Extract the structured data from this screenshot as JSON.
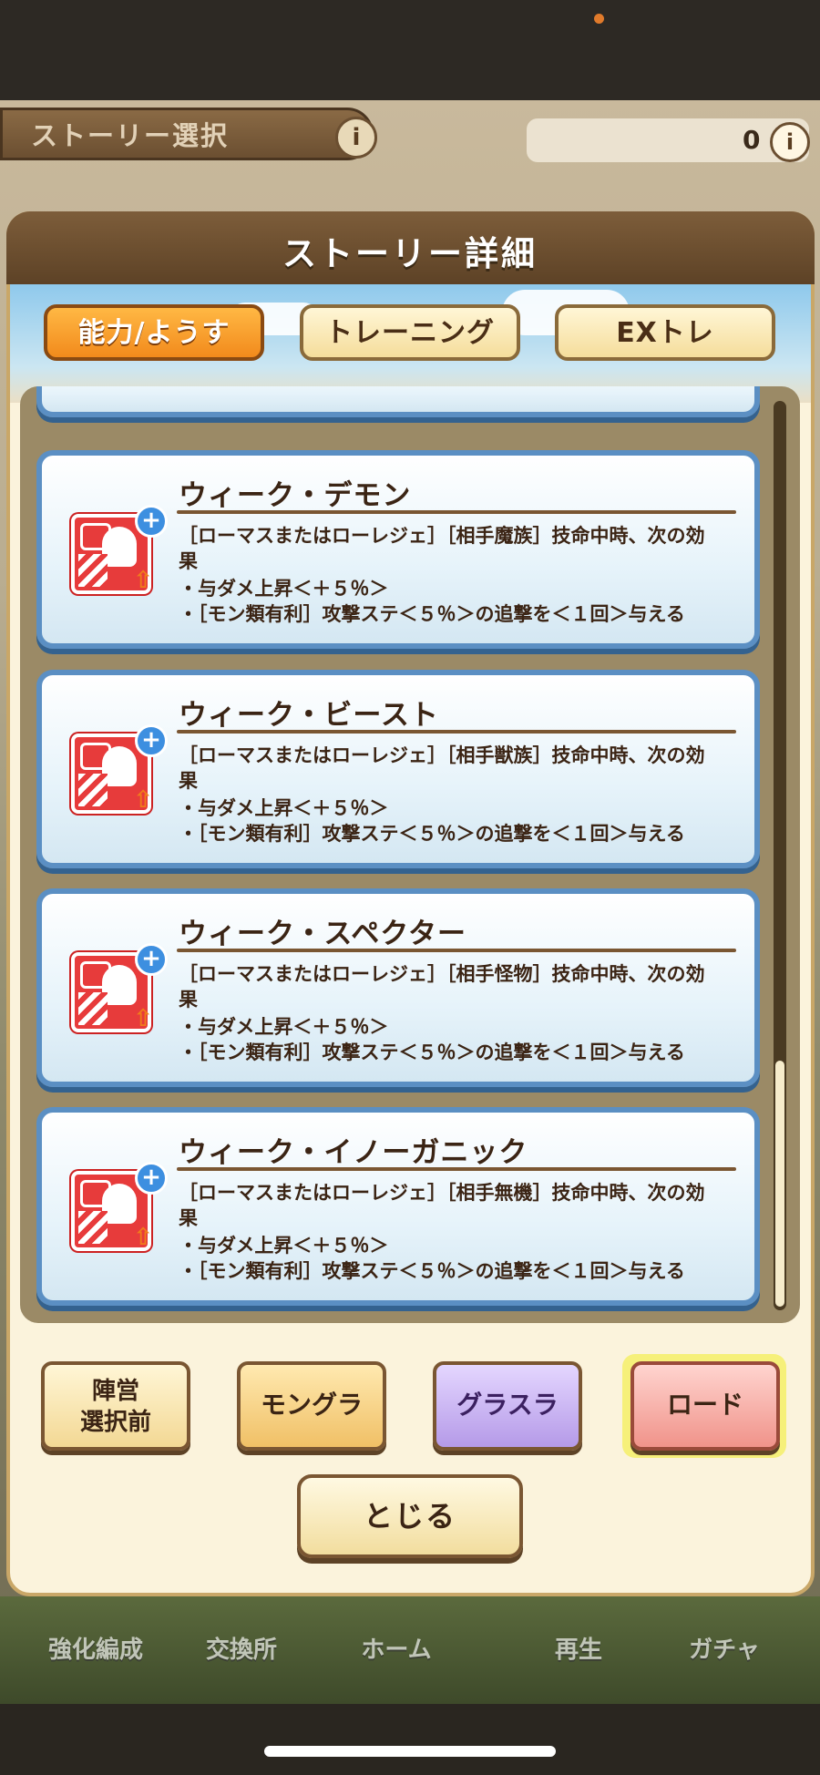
{
  "background": {
    "header_title": "ストーリー選択",
    "currency_value": "0",
    "info_glyph": "i",
    "nav_items": [
      "強化編成",
      "交換所",
      "ホーム",
      "再生",
      "ガチャ"
    ]
  },
  "modal": {
    "title": "ストーリー詳細",
    "tabs": [
      {
        "label": "能力/ようす",
        "active": true
      },
      {
        "label": "トレーニング",
        "active": false
      },
      {
        "label": "EXトレ",
        "active": false
      }
    ],
    "cards": [
      {
        "title": "ウィーク・デモン",
        "icon": "attack-up-icon",
        "lines": [
          "［ローマスまたはローレジェ］［相手魔族］技命中時、次の効",
          "果",
          "・与ダメ上昇＜＋５％＞",
          "・［モン類有利］攻撃ステ＜５％＞の追撃を＜１回＞与える"
        ]
      },
      {
        "title": "ウィーク・ビースト",
        "icon": "attack-up-icon",
        "lines": [
          "［ローマスまたはローレジェ］［相手獣族］技命中時、次の効",
          "果",
          "・与ダメ上昇＜＋５％＞",
          "・［モン類有利］攻撃ステ＜５％＞の追撃を＜１回＞与える"
        ]
      },
      {
        "title": "ウィーク・スペクター",
        "icon": "attack-up-icon",
        "lines": [
          "［ローマスまたはローレジェ］［相手怪物］技命中時、次の効",
          "果",
          "・与ダメ上昇＜＋５％＞",
          "・［モン類有利］攻撃ステ＜５％＞の追撃を＜１回＞与える"
        ]
      },
      {
        "title": "ウィーク・イノーガニック",
        "icon": "attack-up-icon",
        "lines": [
          "［ローマスまたはローレジェ］［相手無機］技命中時、次の効",
          "果",
          "・与ダメ上昇＜＋５％＞",
          "・［モン類有利］攻撃ステ＜５％＞の追撃を＜１回＞与える"
        ]
      }
    ],
    "buttons": {
      "camp_line1": "陣営",
      "camp_line2": "選択前",
      "mongra": "モングラ",
      "grasla": "グラスラ",
      "road": "ロード",
      "close": "とじる"
    },
    "icons": {
      "plus": "+",
      "up": "⇧"
    }
  }
}
